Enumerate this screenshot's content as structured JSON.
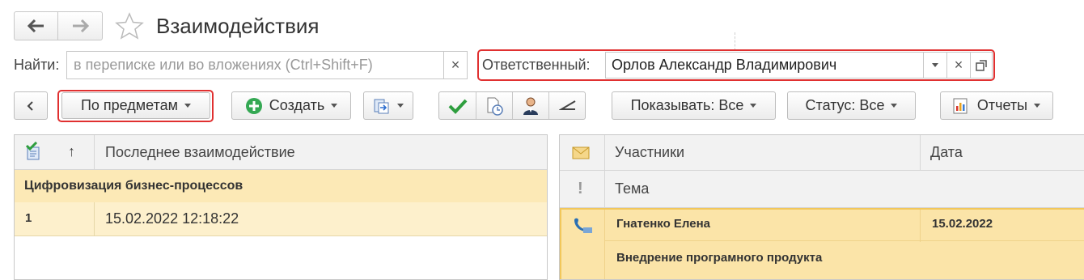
{
  "window": {
    "title": "Взаимодействия"
  },
  "search": {
    "label": "Найти:",
    "placeholder": "в переписке или во вложениях (Ctrl+Shift+F)",
    "clear": "×"
  },
  "responsible": {
    "label": "Ответственный:",
    "value": "Орлов Александр Владимирович",
    "clear": "×"
  },
  "toolbar": {
    "group_by_label": "По предметам",
    "create_label": "Создать",
    "show_label": "Показывать: Все",
    "status_label": "Статус: Все",
    "reports_label": "Отчеты"
  },
  "left_table": {
    "sort_arrow": "↑",
    "header": "Последнее взаимодействие",
    "group_title": "Цифровизация бизнес-процессов",
    "rows": [
      {
        "num": "1",
        "date": "15.02.2022 12:18:22"
      }
    ]
  },
  "right_table": {
    "col_participants": "Участники",
    "col_date": "Дата",
    "col_topic": "Тема",
    "important_mark": "!",
    "rows": [
      {
        "participant": "Гнатенко Елена",
        "date": "15.02.2022",
        "topic": "Внедрение програмного продукта"
      }
    ]
  },
  "colors": {
    "accent_green": "#2e9e3e",
    "highlight": "#fbe4a8",
    "group_row": "#fce9b6",
    "red_outline": "#e03030"
  }
}
